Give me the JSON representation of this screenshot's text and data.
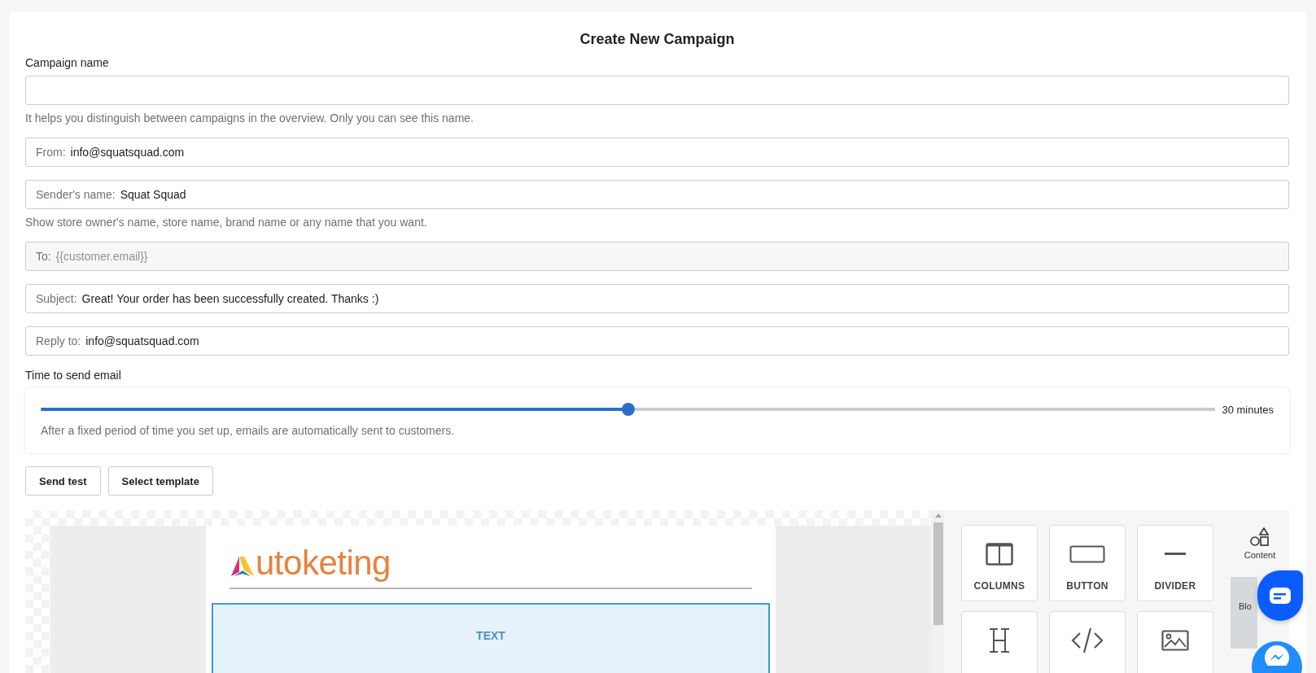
{
  "title": "Create New Campaign",
  "campaign_name": {
    "label": "Campaign name",
    "help": "It helps you distinguish between campaigns in the overview. Only you can see this name."
  },
  "fields": [
    {
      "label": "From:",
      "value": "info@squatsquad.com",
      "disabled": false
    },
    {
      "label": "Sender's name:",
      "value": "Squat Squad",
      "disabled": false,
      "help": "Show store owner's name, store name, brand name or any name that you want."
    },
    {
      "label": "To:",
      "value": "{{customer.email}}",
      "disabled": true
    },
    {
      "label": "Subject:",
      "value": "Great! Your order has been successfully created. Thanks :)",
      "disabled": false
    },
    {
      "label": "Reply to:",
      "value": "info@squatsquad.com",
      "disabled": false
    }
  ],
  "time_to_send": {
    "label": "Time to send email",
    "level": 0.5,
    "reading": "30 minutes",
    "help": "After a fixed period of time you set up, emails are automatically sent to customers."
  },
  "buttons": [
    "Send test",
    "Select template"
  ],
  "editor": {
    "logo": "utoketing",
    "block_label": "TEXT",
    "tools": [
      {
        "kind": "columns",
        "label": "COLUMNS"
      },
      {
        "kind": "button",
        "label": "BUTTON"
      },
      {
        "kind": "divider",
        "label": "DIVIDER"
      },
      {
        "kind": "heading"
      },
      {
        "kind": "html"
      },
      {
        "kind": "image"
      }
    ],
    "tabs": [
      {
        "kind": "content",
        "label": "Content",
        "selected": false
      },
      {
        "label": "Blo",
        "selected": true
      }
    ]
  }
}
